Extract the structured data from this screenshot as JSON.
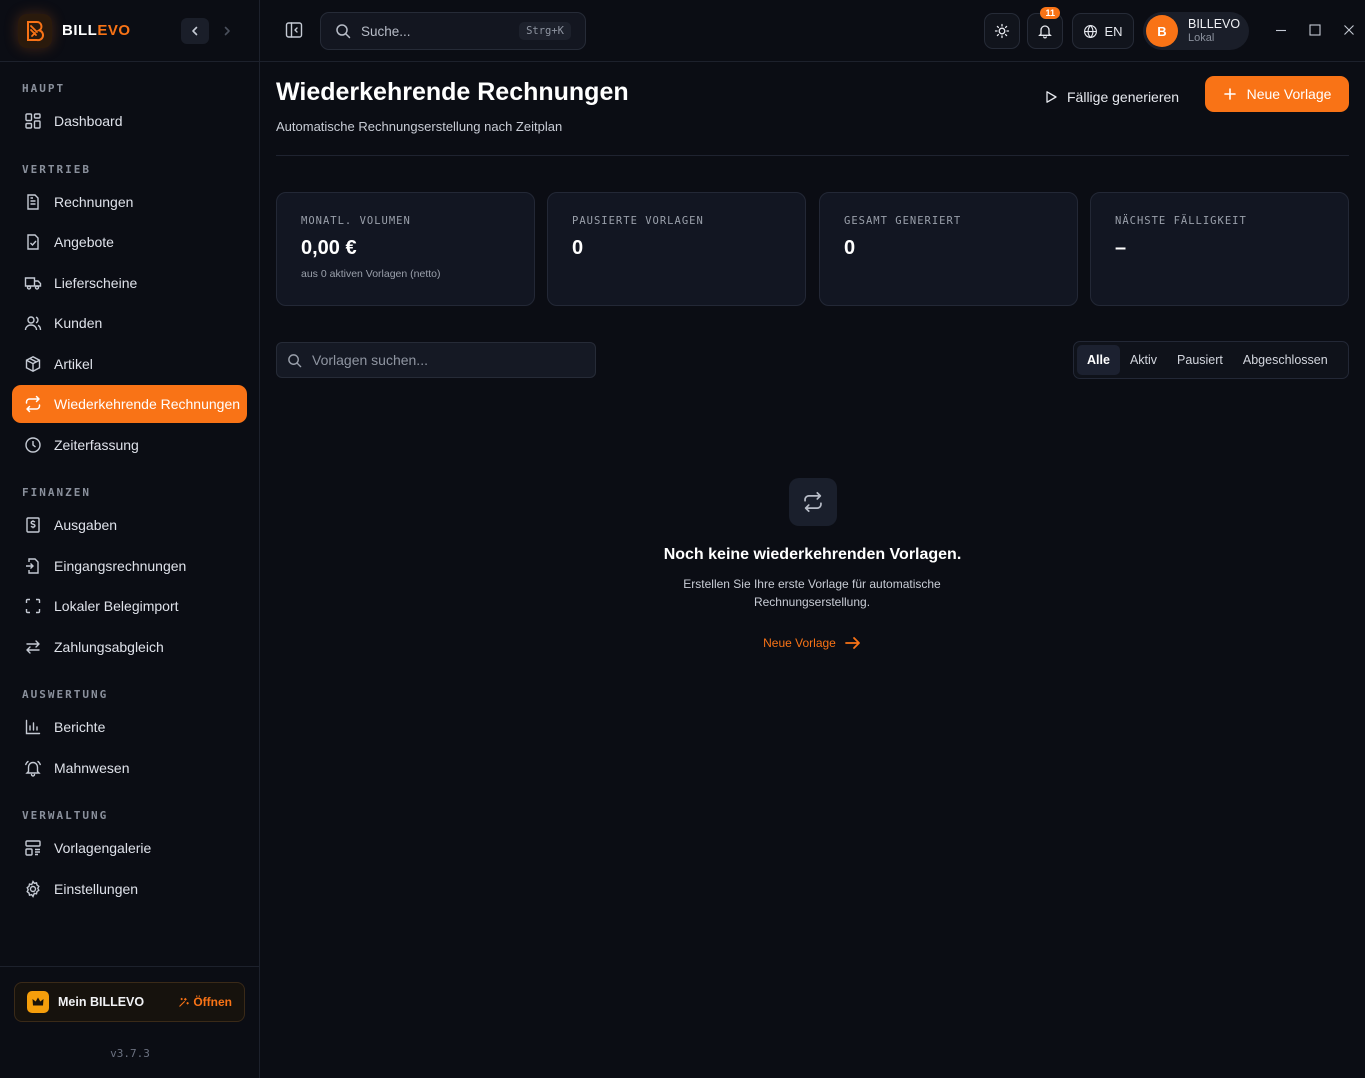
{
  "brand": {
    "name_part1": "BILL",
    "name_part2": "EVO"
  },
  "sidebar": {
    "sections": [
      {
        "label": "HAUPT"
      },
      {
        "label": "VERTRIEB"
      },
      {
        "label": "FINANZEN"
      },
      {
        "label": "AUSWERTUNG"
      },
      {
        "label": "VERWALTUNG"
      }
    ],
    "items": [
      {
        "label": "Dashboard",
        "icon": "dashboard-icon"
      },
      {
        "label": "Rechnungen",
        "icon": "document-icon"
      },
      {
        "label": "Angebote",
        "icon": "document-check-icon"
      },
      {
        "label": "Lieferscheine",
        "icon": "truck-icon"
      },
      {
        "label": "Kunden",
        "icon": "users-icon"
      },
      {
        "label": "Artikel",
        "icon": "box-icon"
      },
      {
        "label": "Wiederkehrende Rechnungen",
        "icon": "repeat-icon",
        "active": true
      },
      {
        "label": "Zeiterfassung",
        "icon": "clock-icon"
      },
      {
        "label": "Ausgaben",
        "icon": "receipt-dollar-icon"
      },
      {
        "label": "Eingangsrechnungen",
        "icon": "file-import-icon"
      },
      {
        "label": "Lokaler Belegimport",
        "icon": "scan-icon"
      },
      {
        "label": "Zahlungsabgleich",
        "icon": "arrows-exchange-icon"
      },
      {
        "label": "Berichte",
        "icon": "bar-chart-icon"
      },
      {
        "label": "Mahnwesen",
        "icon": "bell-ring-icon"
      },
      {
        "label": "Vorlagengalerie",
        "icon": "layout-icon"
      },
      {
        "label": "Einstellungen",
        "icon": "gear-icon"
      }
    ],
    "mein": {
      "label": "Mein BILLEVO",
      "open_label": "Öffnen"
    },
    "version": "v3.7.3"
  },
  "topbar": {
    "search_placeholder": "Suche...",
    "search_shortcut": "Strg+K",
    "notifications_count": "11",
    "language": "EN",
    "user": {
      "initial": "B",
      "name": "BILLEVO",
      "subtitle": "Lokal"
    }
  },
  "page": {
    "title": "Wiederkehrende Rechnungen",
    "subtitle": "Automatische Rechnungserstellung nach Zeitplan",
    "generate_due_label": "Fällige generieren",
    "new_template_label": "Neue Vorlage"
  },
  "stats": [
    {
      "label": "MONATL. VOLUMEN",
      "value": "0,00 €",
      "hint": "aus 0 aktiven Vorlagen (netto)"
    },
    {
      "label": "PAUSIERTE VORLAGEN",
      "value": "0",
      "hint": ""
    },
    {
      "label": "GESAMT GENERIERT",
      "value": "0",
      "hint": ""
    },
    {
      "label": "NÄCHSTE FÄLLIGKEIT",
      "value": "–",
      "hint": ""
    }
  ],
  "templates": {
    "search_placeholder": "Vorlagen suchen...",
    "filters": [
      {
        "label": "Alle",
        "active": true
      },
      {
        "label": "Aktiv"
      },
      {
        "label": "Pausiert"
      },
      {
        "label": "Abgeschlossen"
      }
    ]
  },
  "empty_state": {
    "title": "Noch keine wiederkehrenden Vorlagen.",
    "description": "Erstellen Sie Ihre erste Vorlage für automatische Rechnungserstellung.",
    "link_label": "Neue Vorlage"
  },
  "colors": {
    "accent": "#f97316",
    "background": "#0b0d14",
    "card": "#121622"
  }
}
